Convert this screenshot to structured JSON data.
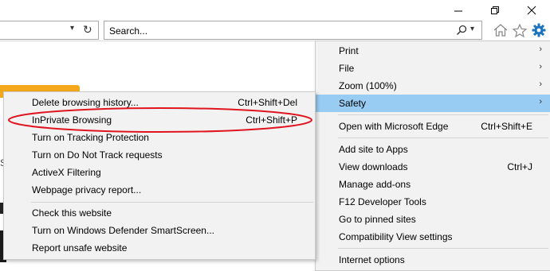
{
  "search": {
    "text": "Search..."
  },
  "main_menu": {
    "items": [
      {
        "label": "Print",
        "arrow": "›"
      },
      {
        "label": "File",
        "arrow": "›"
      },
      {
        "label": "Zoom (100%)",
        "arrow": "›"
      },
      {
        "label": "Safety",
        "arrow": "›",
        "highlighted": true
      },
      {
        "label": "Open with Microsoft Edge",
        "shortcut": "Ctrl+Shift+E"
      },
      {
        "label": "Add site to Apps"
      },
      {
        "label": "View downloads",
        "shortcut": "Ctrl+J"
      },
      {
        "label": "Manage add-ons"
      },
      {
        "label": "F12 Developer Tools"
      },
      {
        "label": "Go to pinned sites"
      },
      {
        "label": "Compatibility View settings"
      },
      {
        "label": "Internet options"
      }
    ]
  },
  "safety_menu": {
    "items": [
      {
        "label": "Delete browsing history...",
        "shortcut": "Ctrl+Shift+Del"
      },
      {
        "label": "InPrivate Browsing",
        "shortcut": "Ctrl+Shift+P"
      },
      {
        "label": "Turn on Tracking Protection"
      },
      {
        "label": "Turn on Do Not Track requests"
      },
      {
        "label": "ActiveX Filtering"
      },
      {
        "label": "Webpage privacy report..."
      },
      {
        "label": "Check this website"
      },
      {
        "label": "Turn on Windows Defender SmartScreen..."
      },
      {
        "label": "Report unsafe website"
      }
    ]
  },
  "page": {
    "partial_text": "Sa"
  },
  "colors": {
    "highlight": "#99ccf3",
    "annotation": "#e0141e",
    "gear": "#1e73be",
    "orange": "#f6a81c"
  }
}
